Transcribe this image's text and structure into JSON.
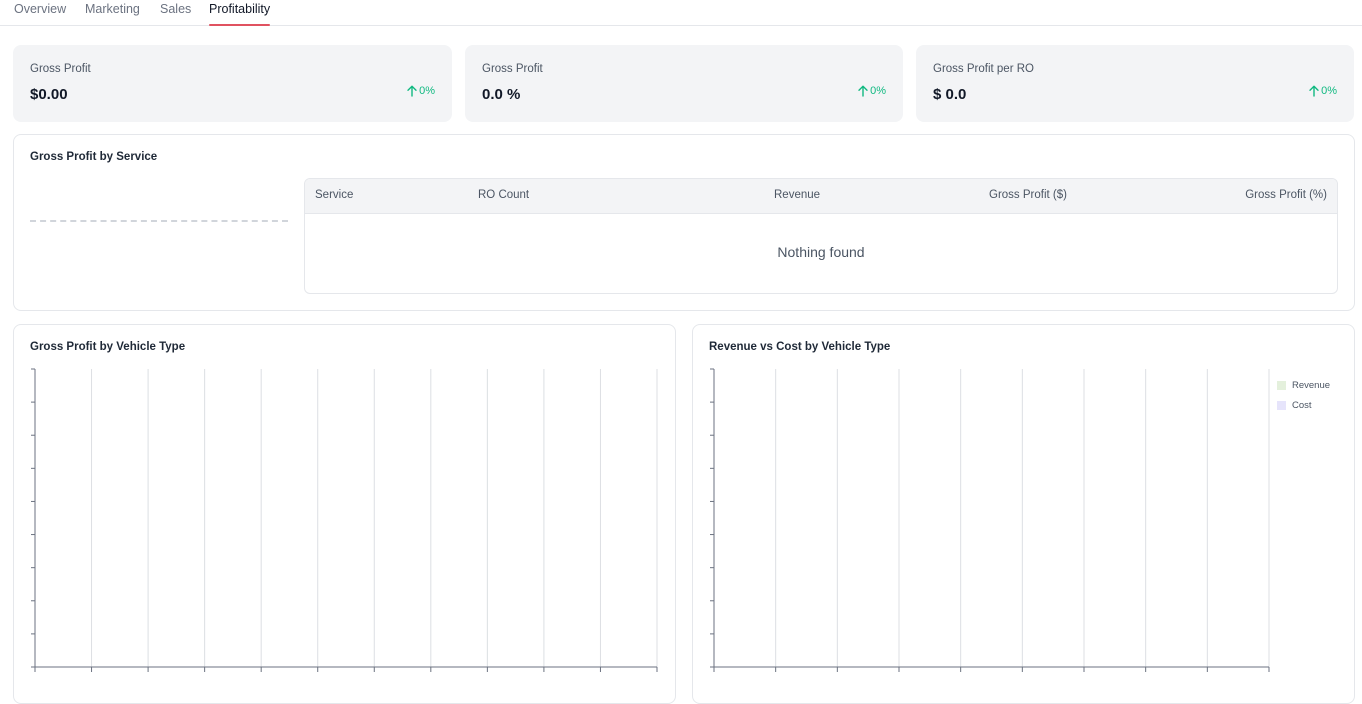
{
  "tabs": [
    {
      "label": "Overview"
    },
    {
      "label": "Marketing"
    },
    {
      "label": "Sales"
    },
    {
      "label": "Profitability",
      "active": true
    }
  ],
  "kpis": [
    {
      "label": "Gross Profit",
      "value": "$0.00",
      "change": "0%"
    },
    {
      "label": "Gross Profit",
      "value": "0.0 %",
      "change": "0%"
    },
    {
      "label": "Gross Profit per RO",
      "value": "$ 0.0",
      "change": "0%"
    }
  ],
  "service_card": {
    "title": "Gross Profit by Service",
    "columns": [
      "Service",
      "RO Count",
      "Revenue",
      "Gross Profit ($)",
      "Gross Profit (%)"
    ],
    "empty_text": "Nothing found"
  },
  "vehicle_card": {
    "title": "Gross Profit by Vehicle Type"
  },
  "revenue_cost_card": {
    "title": "Revenue vs Cost by Vehicle Type",
    "legend": [
      {
        "label": "Revenue",
        "color": "#e4f0dc"
      },
      {
        "label": "Cost",
        "color": "#e6e4fb"
      }
    ]
  },
  "colors": {
    "accent": "#e05260",
    "positive": "#10b981"
  }
}
